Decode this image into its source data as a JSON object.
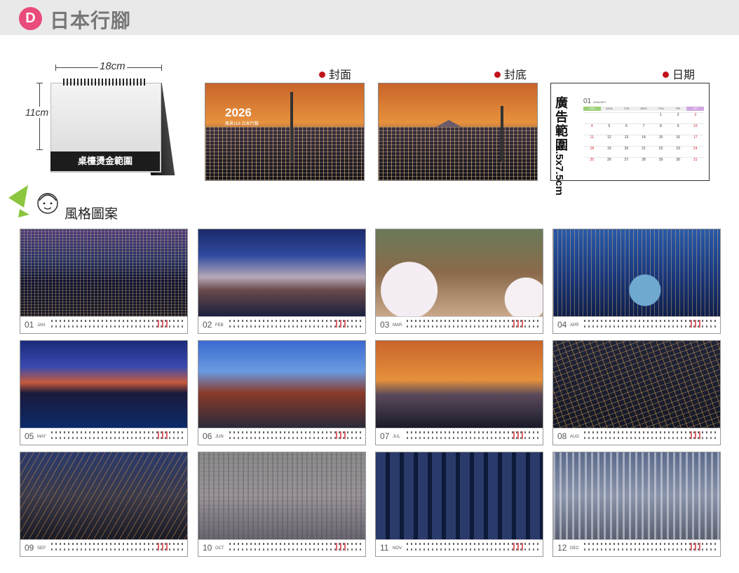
{
  "header": {
    "badge": "D",
    "title": "日本行腳"
  },
  "product": {
    "width_label": "18cm",
    "height_label": "11cm",
    "plate_text": "桌檯燙金範圍"
  },
  "previews": {
    "cover": {
      "label": "封面",
      "year": "2026",
      "subtitle": "風景118·日本行腳"
    },
    "back": {
      "label": "封底"
    },
    "date": {
      "label": "日期",
      "ad_text": "廣告範圍",
      "ad_size": "2.5x7.5cm",
      "month_num": "01",
      "month_name": "JANUARY",
      "weekdays": [
        "SUN",
        "MON",
        "TUE",
        "WED",
        "THU",
        "FRI",
        "SAT"
      ],
      "dates": [
        "",
        "",
        "",
        "",
        "1",
        "2",
        "3",
        "4",
        "5",
        "6",
        "7",
        "8",
        "9",
        "10",
        "11",
        "12",
        "13",
        "14",
        "15",
        "16",
        "17",
        "18",
        "19",
        "20",
        "21",
        "22",
        "23",
        "24",
        "25",
        "26",
        "27",
        "28",
        "29",
        "30",
        "31"
      ]
    }
  },
  "style_section": {
    "label": "風格圖案"
  },
  "months": [
    {
      "num": "01",
      "abbr": "JAN"
    },
    {
      "num": "02",
      "abbr": "FEB"
    },
    {
      "num": "03",
      "abbr": "MAR"
    },
    {
      "num": "04",
      "abbr": "APR"
    },
    {
      "num": "05",
      "abbr": "MAY"
    },
    {
      "num": "06",
      "abbr": "JUN"
    },
    {
      "num": "07",
      "abbr": "JUL"
    },
    {
      "num": "08",
      "abbr": "AUG"
    },
    {
      "num": "09",
      "abbr": "SEP"
    },
    {
      "num": "10",
      "abbr": "OCT"
    },
    {
      "num": "11",
      "abbr": "NOV"
    },
    {
      "num": "12",
      "abbr": "DEC"
    }
  ]
}
